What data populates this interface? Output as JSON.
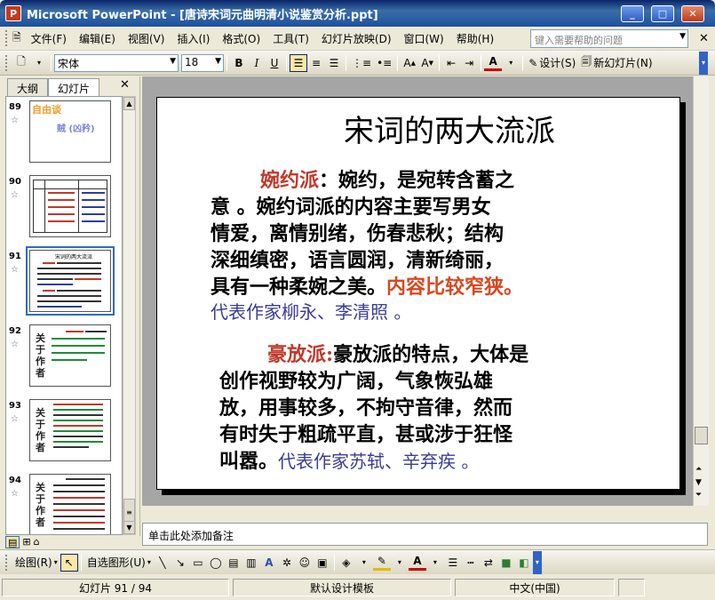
{
  "window": {
    "title": "Microsoft PowerPoint - [唐诗宋词元曲明清小说鉴赏分析.ppt]",
    "app_icon": "P"
  },
  "menu": {
    "items": [
      "文件(F)",
      "编辑(E)",
      "视图(V)",
      "插入(I)",
      "格式(O)",
      "工具(T)",
      "幻灯片放映(D)",
      "窗口(W)",
      "帮助(H)"
    ],
    "help_placeholder": "键入需要帮助的问题"
  },
  "toolbar": {
    "font": "宋体",
    "size": "18",
    "bold": "B",
    "italic": "I",
    "underline": "U",
    "design_label": "设计(S)",
    "new_slide_label": "新幻灯片(N)"
  },
  "panel": {
    "tabs": [
      "大纲",
      "幻灯片"
    ],
    "thumbs": [
      {
        "num": "89",
        "title": "自由谈",
        "sub": "贼 (凶矜)"
      },
      {
        "num": "90"
      },
      {
        "num": "91",
        "title": "宋词的两大流派"
      },
      {
        "num": "92",
        "side": "关于作者"
      },
      {
        "num": "93",
        "side": "关于作者"
      },
      {
        "num": "94",
        "side": "关于作者"
      }
    ],
    "star": "☆"
  },
  "slide": {
    "title": "宋词的两大流派",
    "p1": {
      "label": "婉约派",
      "lines": [
        "：婉约，是宛转含蓄之",
        "意 。婉约词派的内容主要写男女",
        "情爱，离情别绪，伤春悲秋；结构",
        "深细缜密，语言圆润，清新绮丽，",
        "具有一种柔婉之美。"
      ],
      "highlight": "内容比较窄狭。",
      "authors": "代表作家柳永、李清照 。"
    },
    "p2": {
      "label": "豪放派:",
      "lines": [
        "豪放派的特点，大体是",
        "创作视野较为广阔，气象恢弘雄",
        "放，用事较多，不拘守音律，然而",
        "有时失于粗疏平直，甚或涉于狂怪",
        "叫嚣。"
      ],
      "authors": "代表作家苏轼、辛弃疾 。"
    }
  },
  "notes": {
    "placeholder": "单击此处添加备注"
  },
  "drawbar": {
    "draw_label": "绘图(R)",
    "autoshape_label": "自选图形(U)"
  },
  "status": {
    "slide": "幻灯片 91 / 94",
    "template": "默认设计模板",
    "language": "中文(中国)"
  },
  "colors": {
    "title_bar": "#1c50a0",
    "accent_red": "#c0392b",
    "accent_blue": "#3b3b98",
    "editor_bg": "#a5a5a5"
  }
}
